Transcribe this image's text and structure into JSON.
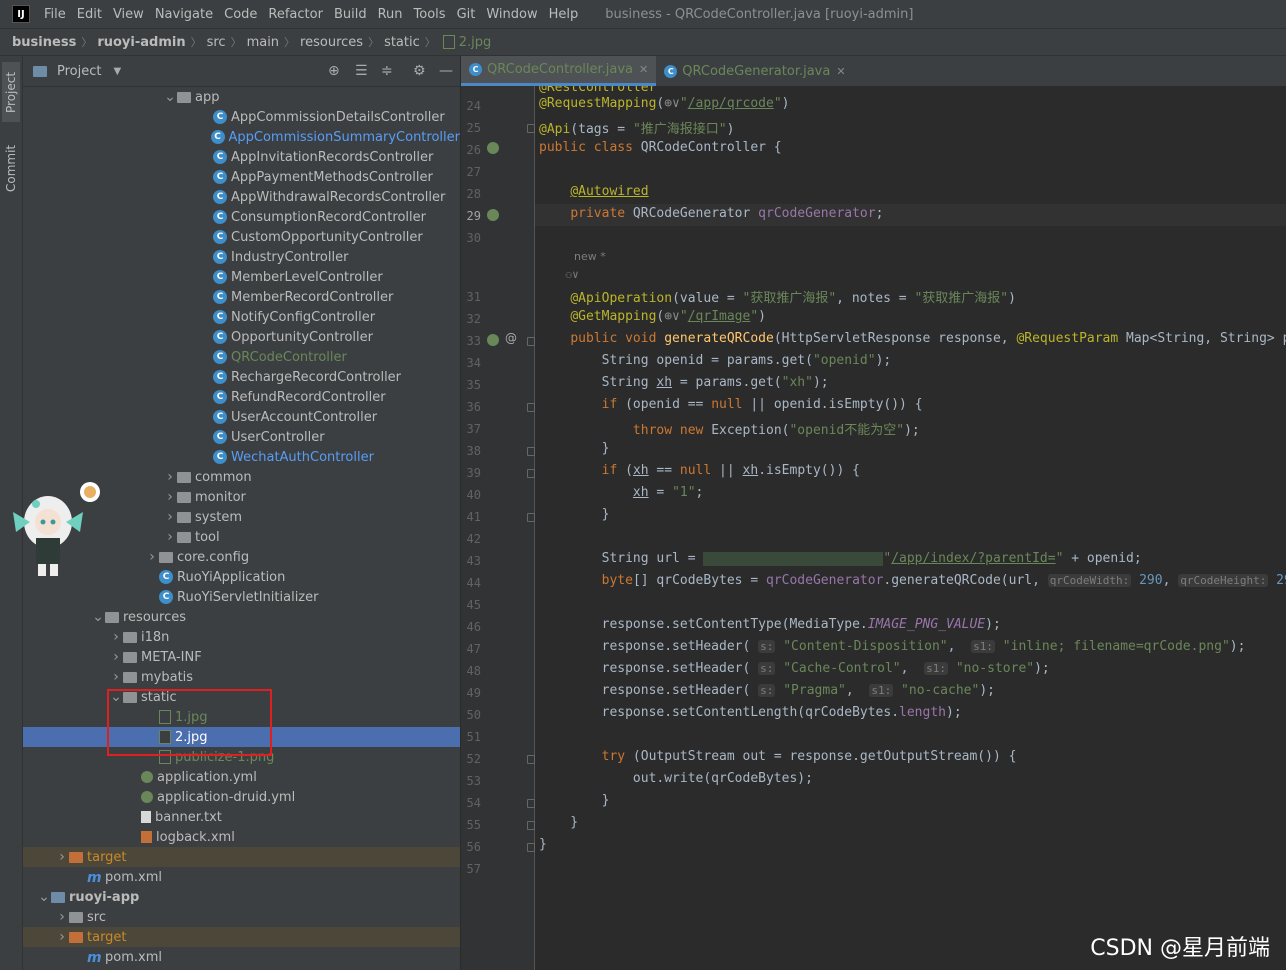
{
  "menubar": {
    "logo": "IJ",
    "items": [
      "File",
      "Edit",
      "View",
      "Navigate",
      "Code",
      "Refactor",
      "Build",
      "Run",
      "Tools",
      "Git",
      "Window",
      "Help"
    ],
    "window_title": "business - QRCodeController.java [ruoyi-admin]"
  },
  "breadcrumb": [
    "business",
    "ruoyi-admin",
    "src",
    "main",
    "resources",
    "static",
    "2.jpg"
  ],
  "left_strip": {
    "project": "Project",
    "commit": "Commit"
  },
  "project_panel": {
    "title": "Project",
    "tree": [
      {
        "label": "app",
        "kind": "folder",
        "depth": 8,
        "expanded": true
      },
      {
        "label": "AppCommissionDetailsController",
        "kind": "class",
        "depth": 10
      },
      {
        "label": "AppCommissionSummaryController",
        "kind": "class",
        "depth": 10,
        "color": "blue"
      },
      {
        "label": "AppInvitationRecordsController",
        "kind": "class",
        "depth": 10
      },
      {
        "label": "AppPaymentMethodsController",
        "kind": "class",
        "depth": 10
      },
      {
        "label": "AppWithdrawalRecordsController",
        "kind": "class",
        "depth": 10
      },
      {
        "label": "ConsumptionRecordController",
        "kind": "class",
        "depth": 10
      },
      {
        "label": "CustomOpportunityController",
        "kind": "class",
        "depth": 10
      },
      {
        "label": "IndustryController",
        "kind": "class",
        "depth": 10
      },
      {
        "label": "MemberLevelController",
        "kind": "class",
        "depth": 10
      },
      {
        "label": "MemberRecordController",
        "kind": "class",
        "depth": 10
      },
      {
        "label": "NotifyConfigController",
        "kind": "class",
        "depth": 10
      },
      {
        "label": "OpportunityController",
        "kind": "class",
        "depth": 10
      },
      {
        "label": "QRCodeController",
        "kind": "class",
        "depth": 10,
        "color": "green"
      },
      {
        "label": "RechargeRecordController",
        "kind": "class",
        "depth": 10
      },
      {
        "label": "RefundRecordController",
        "kind": "class",
        "depth": 10
      },
      {
        "label": "UserAccountController",
        "kind": "class",
        "depth": 10
      },
      {
        "label": "UserController",
        "kind": "class",
        "depth": 10
      },
      {
        "label": "WechatAuthController",
        "kind": "class",
        "depth": 10,
        "color": "blue"
      },
      {
        "label": "common",
        "kind": "folder",
        "depth": 8,
        "expanded": false
      },
      {
        "label": "monitor",
        "kind": "folder",
        "depth": 8,
        "expanded": false
      },
      {
        "label": "system",
        "kind": "folder",
        "depth": 8,
        "expanded": false
      },
      {
        "label": "tool",
        "kind": "folder",
        "depth": 8,
        "expanded": false
      },
      {
        "label": "core.config",
        "kind": "folder",
        "depth": 7,
        "expanded": false
      },
      {
        "label": "RuoYiApplication",
        "kind": "class",
        "depth": 7
      },
      {
        "label": "RuoYiServletInitializer",
        "kind": "class",
        "depth": 7
      },
      {
        "label": "resources",
        "kind": "folder",
        "depth": 4,
        "expanded": true
      },
      {
        "label": "i18n",
        "kind": "folder",
        "depth": 5,
        "expanded": false
      },
      {
        "label": "META-INF",
        "kind": "folder",
        "depth": 5,
        "expanded": false
      },
      {
        "label": "mybatis",
        "kind": "folder",
        "depth": 5,
        "expanded": false
      },
      {
        "label": "static",
        "kind": "folder",
        "depth": 5,
        "expanded": true
      },
      {
        "label": "1.jpg",
        "kind": "img",
        "depth": 7,
        "color": "green"
      },
      {
        "label": "2.jpg",
        "kind": "img",
        "depth": 7,
        "selected": true
      },
      {
        "label": "publicize-1.png",
        "kind": "img",
        "depth": 7,
        "color": "green"
      },
      {
        "label": "application.yml",
        "kind": "yml",
        "depth": 6
      },
      {
        "label": "application-druid.yml",
        "kind": "yml",
        "depth": 6
      },
      {
        "label": "banner.txt",
        "kind": "txt",
        "depth": 6
      },
      {
        "label": "logback.xml",
        "kind": "xml",
        "depth": 6
      },
      {
        "label": "target",
        "kind": "orange-folder",
        "depth": 2,
        "expanded": false,
        "excluded": true
      },
      {
        "label": "pom.xml",
        "kind": "pom",
        "depth": 3
      },
      {
        "label": "ruoyi-app",
        "kind": "module",
        "depth": 1,
        "expanded": true
      },
      {
        "label": "src",
        "kind": "folder",
        "depth": 2,
        "expanded": false
      },
      {
        "label": "target",
        "kind": "orange-folder",
        "depth": 2,
        "expanded": false,
        "excluded": true
      },
      {
        "label": "pom.xml",
        "kind": "pom",
        "depth": 3
      }
    ]
  },
  "editor": {
    "tabs": [
      {
        "label": "QRCodeController.java",
        "active": true
      },
      {
        "label": "QRCodeGenerator.java",
        "active": false
      }
    ],
    "line_numbers": [
      "24",
      "25",
      "26",
      "27",
      "28",
      "29",
      "30",
      "",
      "31",
      "32",
      "33",
      "34",
      "35",
      "36",
      "37",
      "38",
      "39",
      "40",
      "41",
      "42",
      "43",
      "44",
      "45",
      "46",
      "47",
      "48",
      "49",
      "50",
      "51",
      "52",
      "53",
      "54",
      "55",
      "56",
      "57"
    ],
    "hint_new": "new *"
  },
  "watermark": "CSDN @星月前端",
  "colors": {
    "background": "#2b2b2b",
    "panel": "#3c3f41",
    "selection": "#4b6eaf",
    "keyword": "#cc7832",
    "string": "#6a8759",
    "annotation": "#bbb529",
    "highlight_box": "#e02020"
  }
}
